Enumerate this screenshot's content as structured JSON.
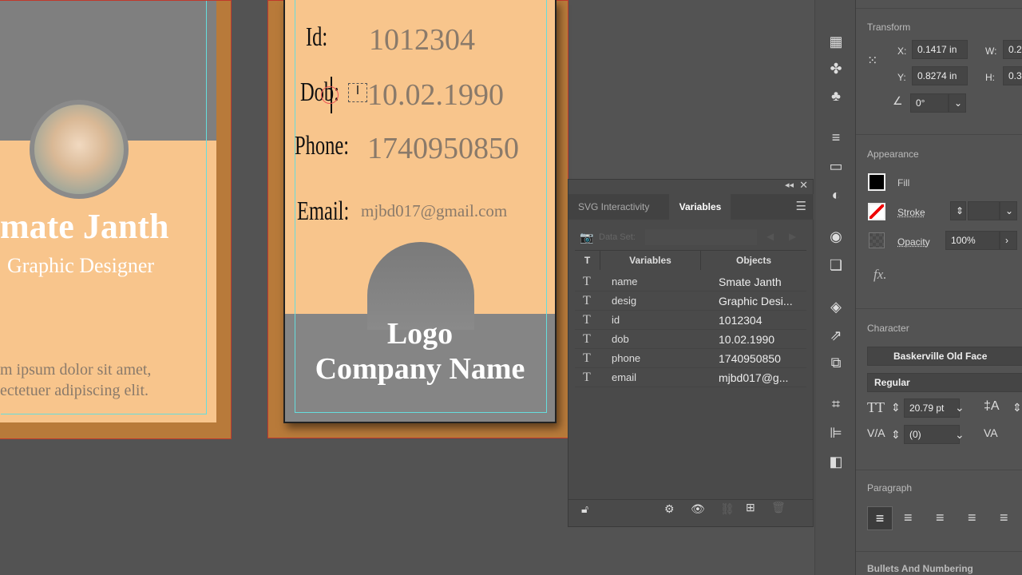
{
  "left_card": {
    "name": "mate Janth",
    "designation": "Graphic Designer",
    "body_line1": "m ipsum dolor sit amet,",
    "body_line2": "ectetuer adipiscing elit."
  },
  "middle_card": {
    "fields": [
      {
        "label": "Id:",
        "value": "1012304"
      },
      {
        "label": "Dob:",
        "value": "10.02.1990"
      },
      {
        "label": "Phone:",
        "value": "1740950850"
      },
      {
        "label": "Email:",
        "value": "mjbd017@gmail.com"
      }
    ],
    "logo": "Logo",
    "company": "Company Name"
  },
  "variables_panel": {
    "tabs": [
      "SVG Interactivity",
      "Variables"
    ],
    "data_set_label": "Data Set:",
    "col_type": "T",
    "col_variables": "Variables",
    "col_objects": "Objects",
    "rows": [
      {
        "type": "T",
        "variable": "name",
        "object": "Smate Janth"
      },
      {
        "type": "T",
        "variable": "desig",
        "object": "Graphic Desi..."
      },
      {
        "type": "T",
        "variable": "id",
        "object": "1012304"
      },
      {
        "type": "T",
        "variable": "dob",
        "object": "10.02.1990"
      },
      {
        "type": "T",
        "variable": "phone",
        "object": "1740950850"
      },
      {
        "type": "T",
        "variable": "email",
        "object": "mjbd017@g..."
      }
    ]
  },
  "properties": {
    "transform": {
      "title": "Transform",
      "x_label": "X:",
      "x": "0.1417 in",
      "y_label": "Y:",
      "y": "0.8274 in",
      "w_label": "W:",
      "w": "0.2",
      "h_label": "H:",
      "h": "0.3",
      "angle": "0°"
    },
    "appearance": {
      "title": "Appearance",
      "fill": "Fill",
      "stroke": "Stroke",
      "opacity_label": "Opacity",
      "opacity": "100%",
      "fx": "fx."
    },
    "character": {
      "title": "Character",
      "font": "Baskerville Old Face",
      "style": "Regular",
      "size": "20.79 pt",
      "leading": "(0)"
    },
    "paragraph": {
      "title": "Paragraph"
    },
    "bullets": {
      "title": "Bullets And Numbering"
    }
  },
  "colors": {
    "card_orange": "#f8c58c",
    "card_frame": "#b87a3a",
    "card_grey": "#858585",
    "guide": "#66dddd",
    "artboard_outline": "#c0392b"
  }
}
